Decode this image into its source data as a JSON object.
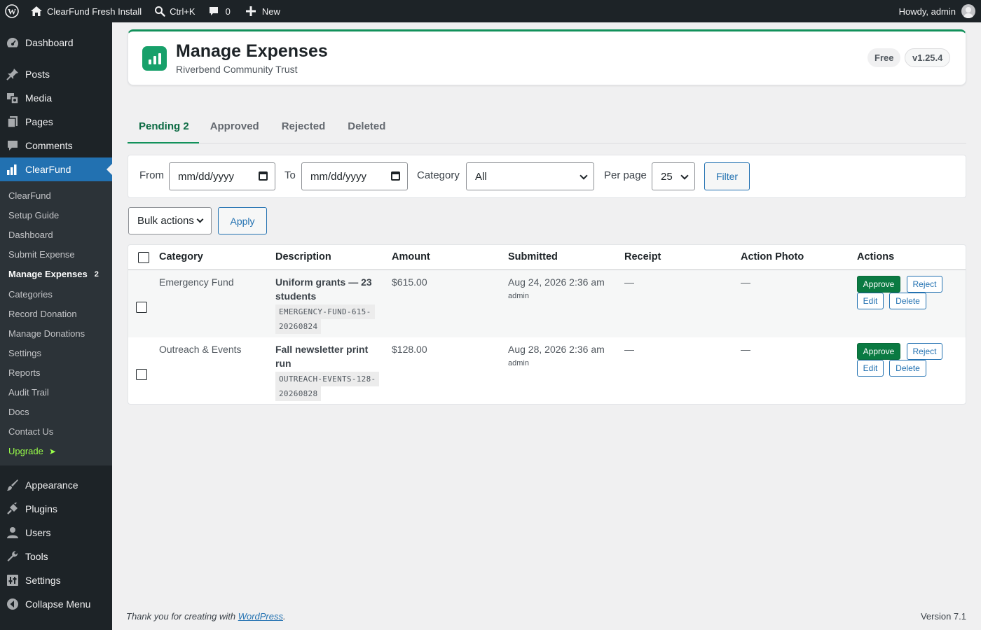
{
  "adminbar": {
    "site_name": "ClearFund Fresh Install",
    "shortcut": "Ctrl+K",
    "comments_count": "0",
    "new_label": "New",
    "greeting": "Howdy, admin"
  },
  "sidebar": {
    "menu_top": [
      {
        "label": "Dashboard",
        "icon": "dashboard-icon"
      },
      {
        "label": "Posts",
        "icon": "pin-icon"
      },
      {
        "label": "Media",
        "icon": "media-icon"
      },
      {
        "label": "Pages",
        "icon": "pages-icon"
      },
      {
        "label": "Comments",
        "icon": "comment-icon"
      },
      {
        "label": "ClearFund",
        "icon": "chart-icon"
      }
    ],
    "submenu": [
      {
        "label": "ClearFund"
      },
      {
        "label": "Setup Guide"
      },
      {
        "label": "Dashboard"
      },
      {
        "label": "Submit Expense"
      },
      {
        "label": "Manage Expenses",
        "count": "2"
      },
      {
        "label": "Categories"
      },
      {
        "label": "Record Donation"
      },
      {
        "label": "Manage Donations"
      },
      {
        "label": "Settings"
      },
      {
        "label": "Reports"
      },
      {
        "label": "Audit Trail"
      },
      {
        "label": "Docs"
      },
      {
        "label": "Contact Us"
      },
      {
        "label": "Upgrade",
        "arrow": "➤"
      }
    ],
    "menu_bottom": [
      {
        "label": "Appearance",
        "icon": "brush-icon"
      },
      {
        "label": "Plugins",
        "icon": "plug-icon"
      },
      {
        "label": "Users",
        "icon": "user-icon"
      },
      {
        "label": "Tools",
        "icon": "wrench-icon"
      },
      {
        "label": "Settings",
        "icon": "settings-icon"
      },
      {
        "label": "Collapse Menu",
        "icon": "collapse-icon"
      }
    ],
    "brand_accent": "#2271b1"
  },
  "header": {
    "title": "Manage Expenses",
    "subtitle": "Riverbend Community Trust",
    "plan_badge": "Free",
    "version_badge": "v1.25.4",
    "brand_color": "#12915b"
  },
  "tabs": [
    {
      "label": "Pending 2"
    },
    {
      "label": "Approved"
    },
    {
      "label": "Rejected"
    },
    {
      "label": "Deleted"
    }
  ],
  "filters": {
    "from_label": "From",
    "from_value": "mm/dd/yyyy",
    "to_label": "To",
    "to_value": "mm/dd/yyyy",
    "category_label": "Category",
    "category_value": "All",
    "per_page_label": "Per page",
    "per_page_value": "25",
    "filter_button": "Filter"
  },
  "bulk": {
    "select_value": "Bulk actions",
    "apply_button": "Apply"
  },
  "table": {
    "columns": [
      "Category",
      "Description",
      "Amount",
      "Submitted",
      "Receipt",
      "Action Photo",
      "Actions"
    ],
    "rows": [
      {
        "category": "Emergency Fund",
        "description_line1": "Uniform grants — 23",
        "description_line2": "students",
        "code_line1": "EMERGENCY-FUND-615-",
        "code_line2": "20260824",
        "amount": "$615.00",
        "submitted": "Aug 24, 2026 2:36 am",
        "submitted_by": "admin",
        "receipt": "—",
        "action_photo": "—"
      },
      {
        "category": "Outreach & Events",
        "description_line1": "Fall newsletter print",
        "description_line2": "run",
        "code_line1": "OUTREACH-EVENTS-128-",
        "code_line2": "20260828",
        "amount": "$128.00",
        "submitted": "Aug 28, 2026 2:36 am",
        "submitted_by": "admin",
        "receipt": "—",
        "action_photo": "—"
      }
    ],
    "actions": {
      "approve": "Approve",
      "reject": "Reject",
      "edit": "Edit",
      "delete": "Delete"
    }
  },
  "footer": {
    "thanks_prefix": "Thank you for creating with ",
    "thanks_link": "WordPress",
    "thanks_suffix": ".",
    "version": "Version 7.1"
  }
}
